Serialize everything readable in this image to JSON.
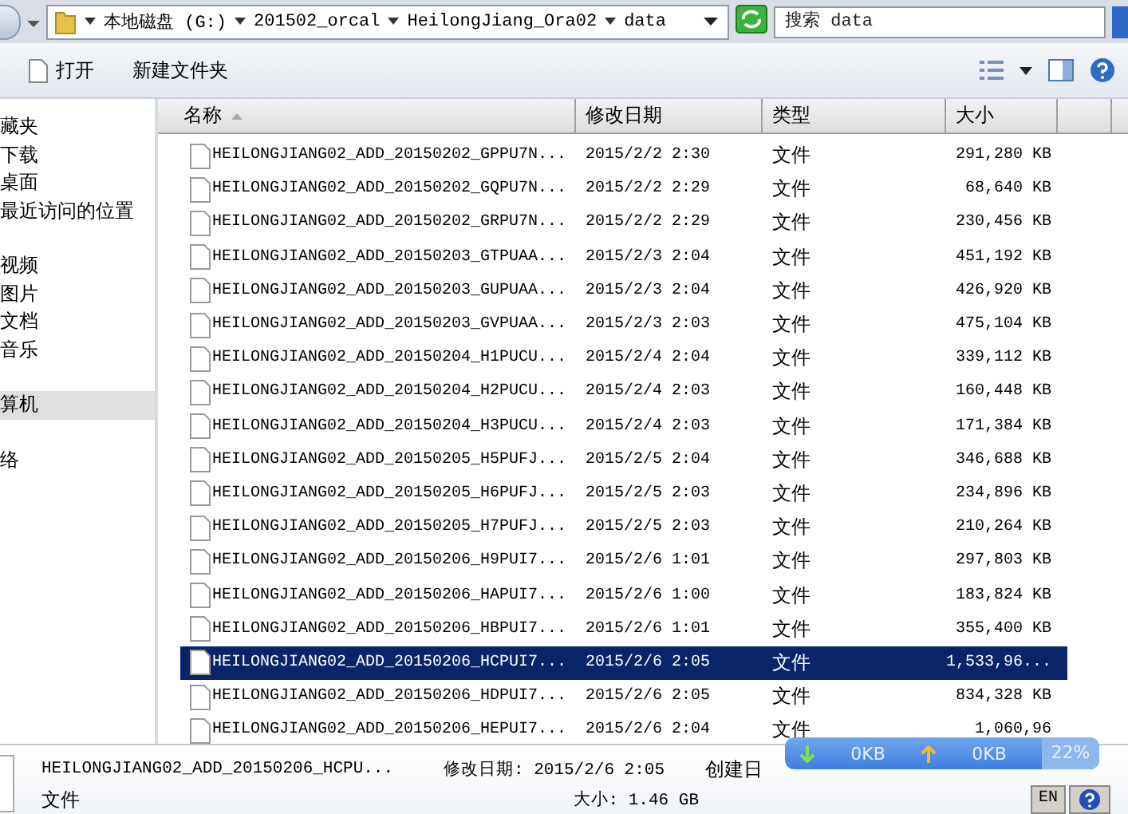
{
  "address_bar": {
    "path": [
      "本地磁盘 (G:)",
      "201502_orcal",
      "HeilongJiang_Ora02",
      "data"
    ],
    "search": {
      "placeholder": "搜索 data"
    }
  },
  "toolbar": {
    "buttons": [
      {
        "label": "打开",
        "kind": "open"
      },
      {
        "label": "新建文件夹",
        "kind": "plain"
      }
    ]
  },
  "sidebar": {
    "groups": [
      {
        "items": [
          {
            "label": "藏夹",
            "selected": false
          },
          {
            "label": "下载",
            "selected": false
          },
          {
            "label": "桌面",
            "selected": false
          },
          {
            "label": "最近访问的位置",
            "selected": false
          }
        ]
      },
      {
        "items": [
          {
            "label": "视频",
            "selected": false
          },
          {
            "label": "图片",
            "selected": false
          },
          {
            "label": "文档",
            "selected": false
          },
          {
            "label": "音乐",
            "selected": false
          }
        ]
      },
      {
        "items": [
          {
            "label": "算机",
            "selected": true
          }
        ]
      },
      {
        "items": [
          {
            "label": "络",
            "selected": false
          }
        ]
      }
    ]
  },
  "table": {
    "columns": [
      {
        "label": "名称",
        "sorted": true
      },
      {
        "label": "修改日期",
        "sorted": false
      },
      {
        "label": "类型",
        "sorted": false
      },
      {
        "label": "大小",
        "sorted": false
      }
    ],
    "rows": [
      {
        "name": "HEILONGJIANG02_ADD_20150202_GPPU7N...",
        "date": "2015/2/2 2:30",
        "type": "文件",
        "size": "291,280 KB",
        "selected": false
      },
      {
        "name": "HEILONGJIANG02_ADD_20150202_GQPU7N...",
        "date": "2015/2/2 2:29",
        "type": "文件",
        "size": "68,640 KB",
        "selected": false
      },
      {
        "name": "HEILONGJIANG02_ADD_20150202_GRPU7N...",
        "date": "2015/2/2 2:29",
        "type": "文件",
        "size": "230,456 KB",
        "selected": false
      },
      {
        "name": "HEILONGJIANG02_ADD_20150203_GTPUAA...",
        "date": "2015/2/3 2:04",
        "type": "文件",
        "size": "451,192 KB",
        "selected": false
      },
      {
        "name": "HEILONGJIANG02_ADD_20150203_GUPUAA...",
        "date": "2015/2/3 2:04",
        "type": "文件",
        "size": "426,920 KB",
        "selected": false
      },
      {
        "name": "HEILONGJIANG02_ADD_20150203_GVPUAA...",
        "date": "2015/2/3 2:03",
        "type": "文件",
        "size": "475,104 KB",
        "selected": false
      },
      {
        "name": "HEILONGJIANG02_ADD_20150204_H1PUCU...",
        "date": "2015/2/4 2:04",
        "type": "文件",
        "size": "339,112 KB",
        "selected": false
      },
      {
        "name": "HEILONGJIANG02_ADD_20150204_H2PUCU...",
        "date": "2015/2/4 2:03",
        "type": "文件",
        "size": "160,448 KB",
        "selected": false
      },
      {
        "name": "HEILONGJIANG02_ADD_20150204_H3PUCU...",
        "date": "2015/2/4 2:03",
        "type": "文件",
        "size": "171,384 KB",
        "selected": false
      },
      {
        "name": "HEILONGJIANG02_ADD_20150205_H5PUFJ...",
        "date": "2015/2/5 2:04",
        "type": "文件",
        "size": "346,688 KB",
        "selected": false
      },
      {
        "name": "HEILONGJIANG02_ADD_20150205_H6PUFJ...",
        "date": "2015/2/5 2:03",
        "type": "文件",
        "size": "234,896 KB",
        "selected": false
      },
      {
        "name": "HEILONGJIANG02_ADD_20150205_H7PUFJ...",
        "date": "2015/2/5 2:03",
        "type": "文件",
        "size": "210,264 KB",
        "selected": false
      },
      {
        "name": "HEILONGJIANG02_ADD_20150206_H9PUI7...",
        "date": "2015/2/6 1:01",
        "type": "文件",
        "size": "297,803 KB",
        "selected": false
      },
      {
        "name": "HEILONGJIANG02_ADD_20150206_HAPUI7...",
        "date": "2015/2/6 1:00",
        "type": "文件",
        "size": "183,824 KB",
        "selected": false
      },
      {
        "name": "HEILONGJIANG02_ADD_20150206_HBPUI7...",
        "date": "2015/2/6 1:01",
        "type": "文件",
        "size": "355,400 KB",
        "selected": false
      },
      {
        "name": "HEILONGJIANG02_ADD_20150206_HCPUI7...",
        "date": "2015/2/6 2:05",
        "type": "文件",
        "size": "1,533,96...",
        "selected": true
      },
      {
        "name": "HEILONGJIANG02_ADD_20150206_HDPUI7...",
        "date": "2015/2/6 2:05",
        "type": "文件",
        "size": "834,328 KB",
        "selected": false
      },
      {
        "name": "HEILONGJIANG02_ADD_20150206_HEPUI7...",
        "date": "2015/2/6 2:04",
        "type": "文件",
        "size": "1,060,96",
        "selected": false
      }
    ]
  },
  "details": {
    "name": "HEILONGJIANG02_ADD_20150206_HCPU...",
    "type": "文件",
    "modified": "修改日期: 2015/2/6 2:05",
    "size": "大小: 1.46 GB",
    "created": "创建日"
  },
  "net_widget": {
    "download": "0KB",
    "upload": "0KB",
    "percent": "22%"
  },
  "taskbar": {
    "language": "EN"
  }
}
